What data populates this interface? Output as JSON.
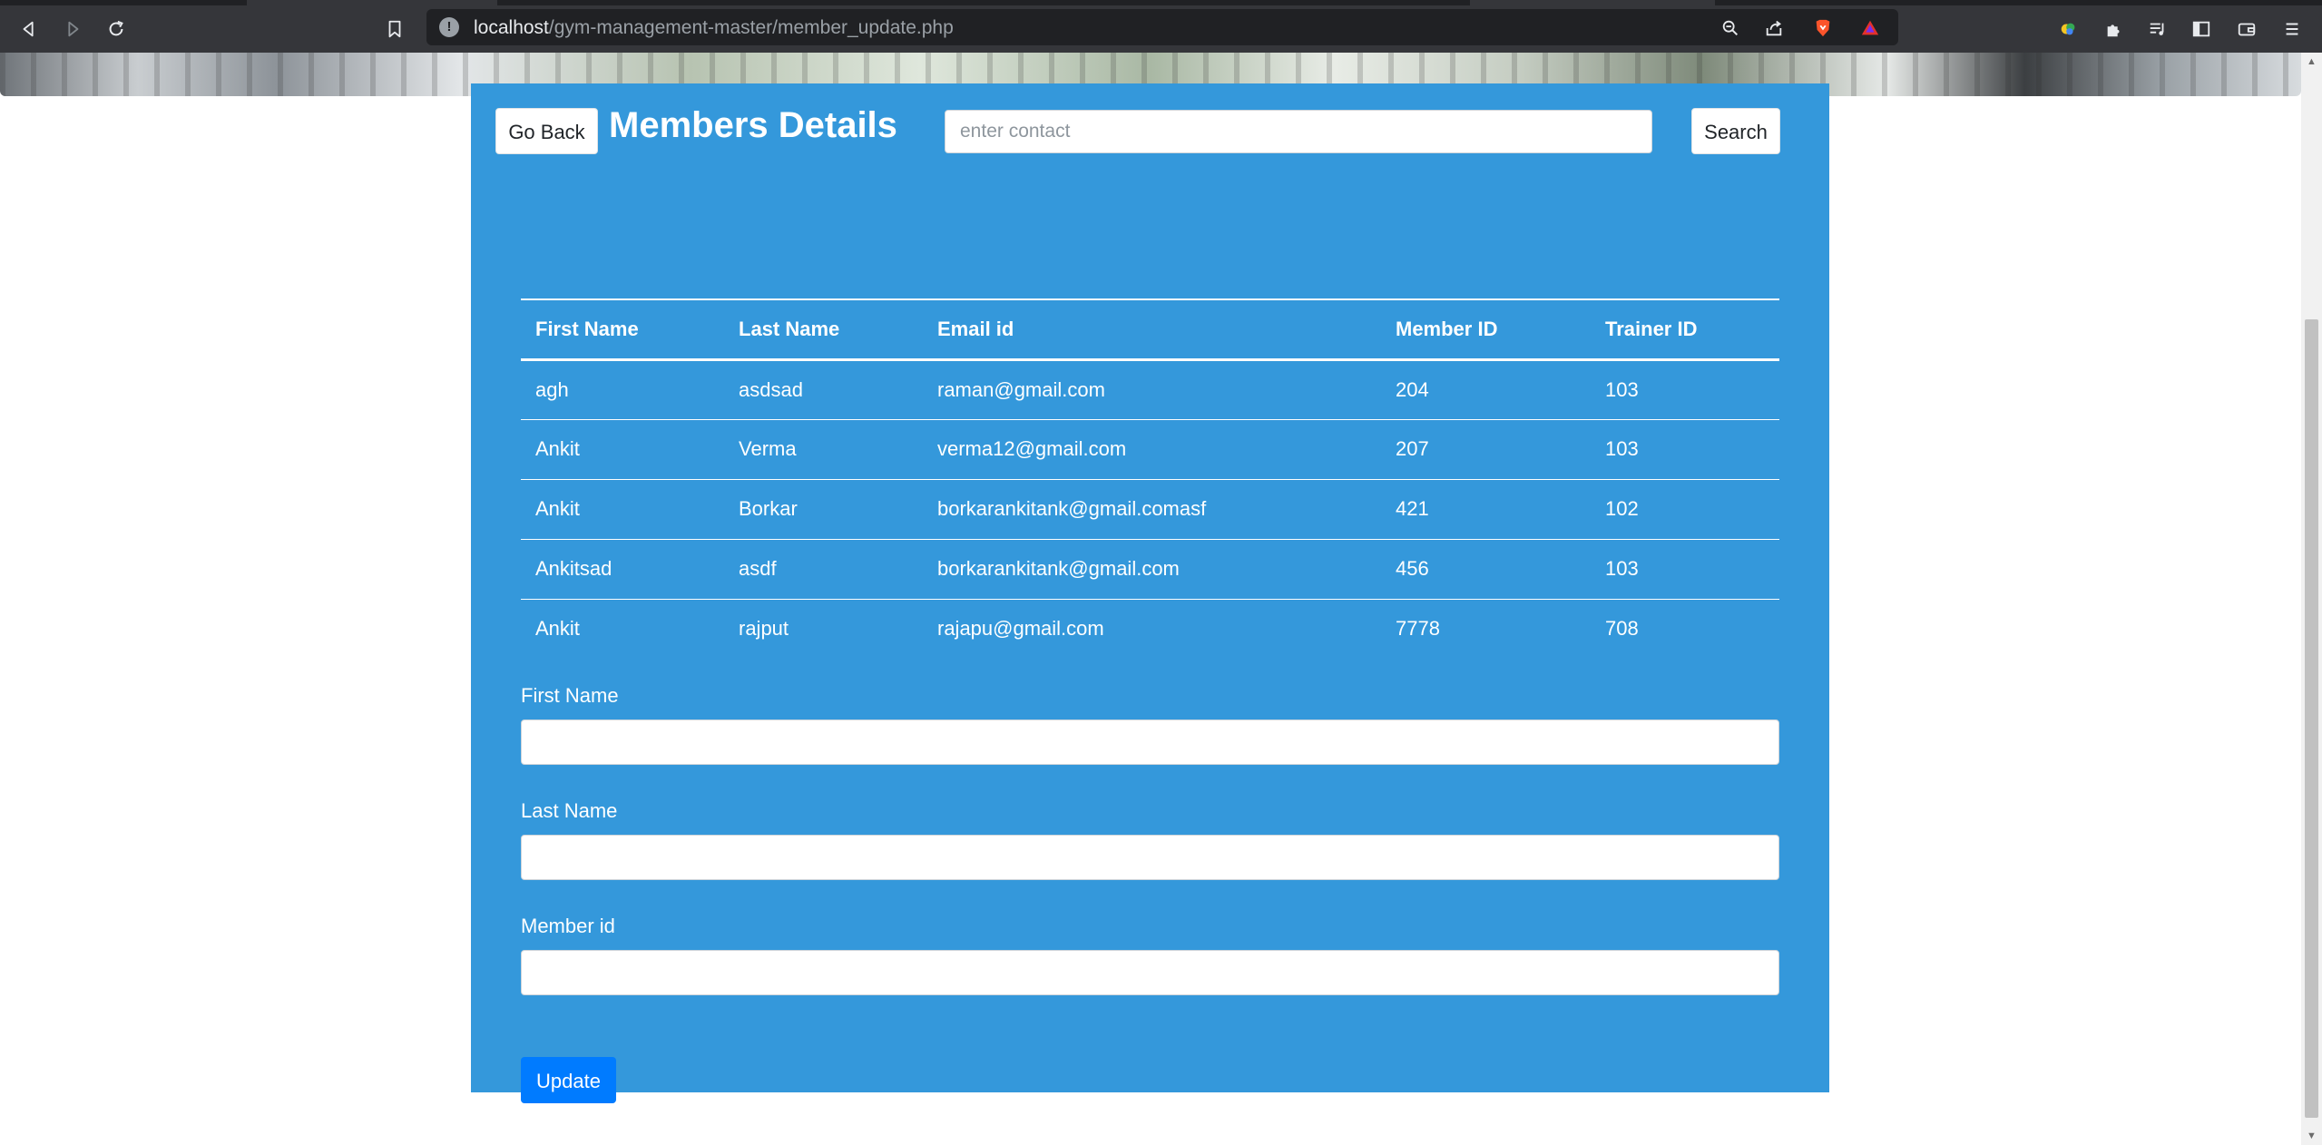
{
  "browser": {
    "url_host": "localhost",
    "url_path": "/gym-management-master/member_update.php"
  },
  "page": {
    "go_back_label": "Go Back",
    "title": "Members Details",
    "search_placeholder": "enter contact",
    "search_label": "Search",
    "panel_color": "#3498db",
    "update_button_color": "#007bff"
  },
  "table": {
    "headers": [
      "First Name",
      "Last Name",
      "Email id",
      "Member ID",
      "Trainer ID"
    ],
    "rows": [
      [
        "agh",
        "asdsad",
        "raman@gmail.com",
        "204",
        "103"
      ],
      [
        "Ankit",
        "Verma",
        "verma12@gmail.com",
        "207",
        "103"
      ],
      [
        "Ankit",
        "Borkar",
        "borkarankitank@gmail.comasf",
        "421",
        "102"
      ],
      [
        "Ankitsad",
        "asdf",
        "borkarankitank@gmail.com",
        "456",
        "103"
      ],
      [
        "Ankit",
        "rajput",
        "rajapu@gmail.com",
        "7778",
        "708"
      ]
    ]
  },
  "form": {
    "first_name_label": "First Name",
    "first_name_value": "",
    "last_name_label": "Last Name",
    "last_name_value": "",
    "member_id_label": "Member id",
    "member_id_value": "",
    "update_label": "Update"
  }
}
